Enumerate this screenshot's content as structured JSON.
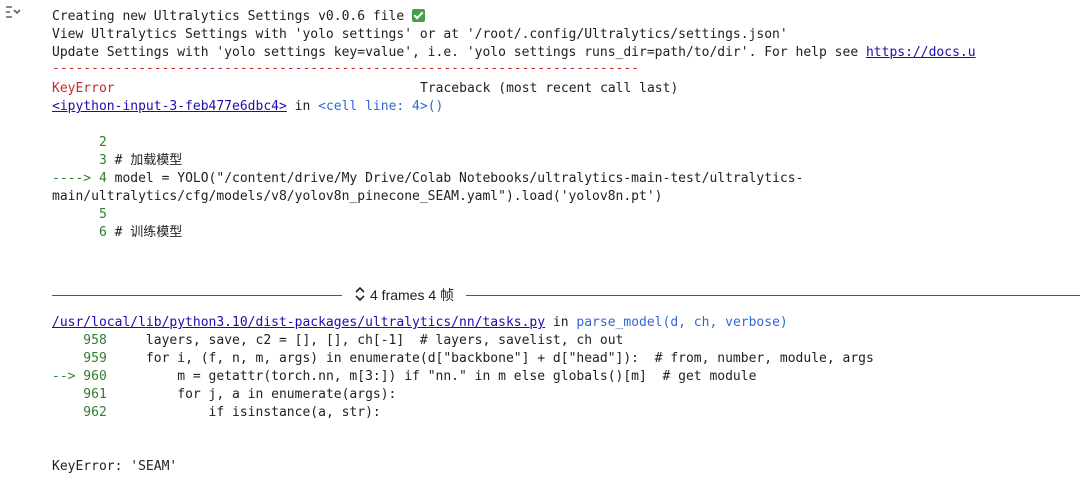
{
  "output_icon": "collapse-output-icon",
  "settings": {
    "line1": "Creating new Ultralytics Settings v0.0.6 file",
    "line2": "View Ultralytics Settings with 'yolo settings' or at '/root/.config/Ultralytics/settings.json'",
    "line3_prefix": "Update Settings with 'yolo settings key=value', i.e. 'yolo settings runs_dir=path/to/dir'. For help see ",
    "line3_link": "https://docs.u"
  },
  "traceback": {
    "separator": "---------------------------------------------------------------------------",
    "error_name": "KeyError",
    "header": "Traceback (most recent call last)",
    "input_link": "<ipython-input-3-feb477e6dbc4>",
    "in_word": " in ",
    "cell_line": "<cell line: 4>()",
    "code1": [
      {
        "num": "      2",
        "text": ""
      },
      {
        "num": "      3",
        "text": " # 加载模型"
      },
      {
        "num": "----> 4",
        "text": " model = YOLO(\"/content/drive/My Drive/Colab Notebooks/ultralytics-main-test/ultralytics-"
      },
      {
        "num": "",
        "text": "main/ultralytics/cfg/models/v8/yolov8n_pinecone_SEAM.yaml\").load('yolov8n.pt')"
      },
      {
        "num": "      5",
        "text": ""
      },
      {
        "num": "      6",
        "text": " # 训练模型"
      }
    ],
    "frames_label": "4 frames 4 帧",
    "file_link": "/usr/local/lib/python3.10/dist-packages/ultralytics/nn/tasks.py",
    "file_in": " in ",
    "func": "parse_model(d, ch, verbose)",
    "code2": [
      {
        "num": "    958",
        "text": "     layers, save, c2 = [], [], ch[-1]  # layers, savelist, ch out"
      },
      {
        "num": "    959",
        "text": "     for i, (f, n, m, args) in enumerate(d[\"backbone\"] + d[\"head\"]):  # from, number, module, args"
      },
      {
        "num": "--> 960",
        "text": "         m = getattr(torch.nn, m[3:]) if \"nn.\" in m else globals()[m]  # get module"
      },
      {
        "num": "    961",
        "text": "         for j, a in enumerate(args):"
      },
      {
        "num": "    962",
        "text": "             if isinstance(a, str):"
      }
    ],
    "final_error": "KeyError: 'SEAM'"
  }
}
